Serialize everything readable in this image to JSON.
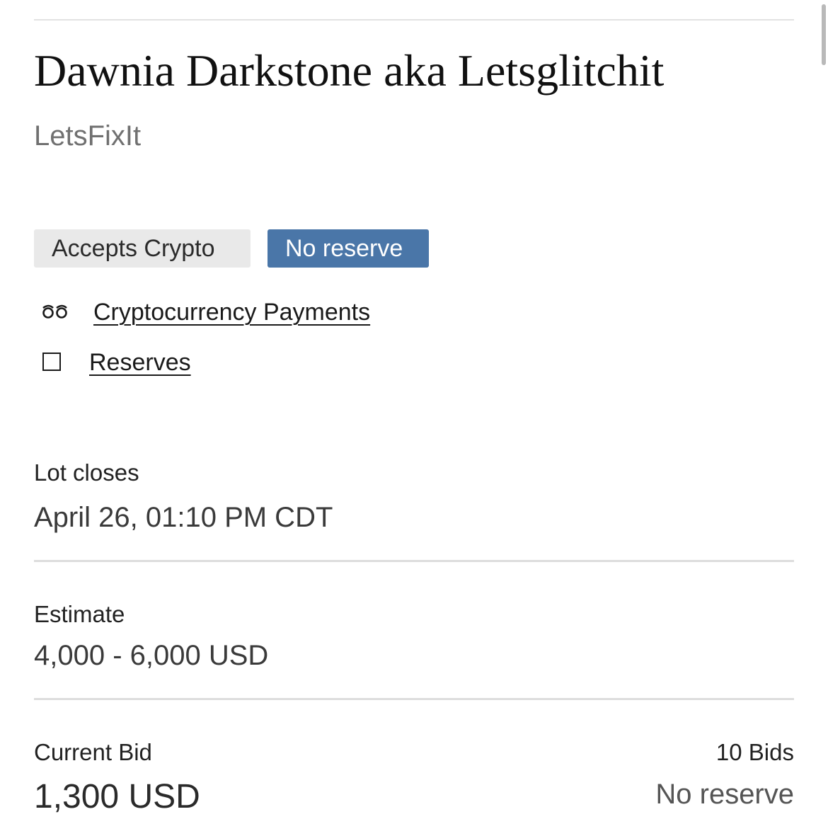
{
  "lot": {
    "title": "Dawnia Darkstone aka Letsglitchit",
    "artist": "LetsFixIt"
  },
  "badges": {
    "crypto": "Accepts Crypto",
    "reserve": "No reserve"
  },
  "info_links": {
    "crypto_icon_glyph": "ꝏ",
    "crypto_icon": "crypto-symbol-icon",
    "crypto_label": "Cryptocurrency Payments",
    "reserves_icon": "square-outline-icon",
    "reserves_label": "Reserves"
  },
  "closing": {
    "label": "Lot closes",
    "value": "April 26, 01:10 PM CDT"
  },
  "estimate": {
    "label": "Estimate",
    "value": "4,000 - 6,000 USD"
  },
  "bid": {
    "label": "Current Bid",
    "value": "1,300 USD",
    "count": "10 Bids",
    "reserve_status": "No reserve"
  },
  "colors": {
    "badge_crypto_bg": "#e9e9e9",
    "badge_reserve_bg": "#4a76a8",
    "divider": "#dddddd",
    "text_muted": "#707070"
  }
}
